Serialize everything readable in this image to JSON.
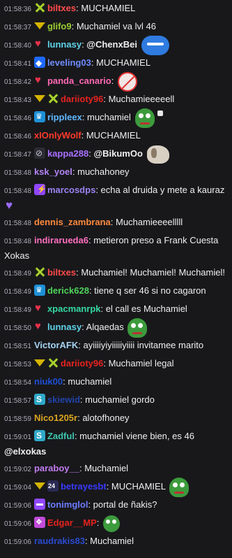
{
  "messages": [
    {
      "ts": "01:58:36",
      "badges": [
        "x-icon"
      ],
      "user": "biltxes",
      "user_color": "#ff4b4b",
      "parts": [
        {
          "t": "text",
          "v": "MUCHAMIEL"
        }
      ]
    },
    {
      "ts": "01:58:37",
      "badges": [
        "chevron-icon"
      ],
      "user": "glifo9",
      "user_color": "#9acd32",
      "parts": [
        {
          "t": "text",
          "v": "Muchamiel va lvl 46"
        }
      ]
    },
    {
      "ts": "01:58:40",
      "badges": [
        "heart-icon"
      ],
      "user": "lunnasy",
      "user_color": "#5fd3e8",
      "parts": [
        {
          "t": "mention",
          "v": "@ChenxBei"
        },
        {
          "t": "emote",
          "v": "e-blue"
        }
      ]
    },
    {
      "ts": "01:58:41",
      "badges": [
        "diamond-icon"
      ],
      "user": "leveling03",
      "user_color": "#6f8cff",
      "parts": [
        {
          "t": "text",
          "v": "MUCHAMIEL"
        }
      ]
    },
    {
      "ts": "01:58:42",
      "badges": [
        "heart-icon"
      ],
      "user": "panda_canario",
      "user_color": "#ff69b4",
      "parts": [
        {
          "t": "emote",
          "v": "e-nope"
        }
      ]
    },
    {
      "ts": "01:58:43",
      "badges": [
        "chevron-icon",
        "x-icon"
      ],
      "user": "dariioty96",
      "user_color": "#e5231f",
      "parts": [
        {
          "t": "text",
          "v": "Muchamieeeeell"
        }
      ]
    },
    {
      "ts": "01:58:46",
      "badges": [
        "crown-icon"
      ],
      "user": "rippleex",
      "user_color": "#5fb8ff",
      "parts": [
        {
          "t": "text",
          "v": "muchamiel"
        },
        {
          "t": "emote",
          "v": "e-frog"
        },
        {
          "t": "emote",
          "v": "e-tiny"
        }
      ]
    },
    {
      "ts": "01:58:46",
      "badges": [],
      "user": "xIOnlyWolf",
      "user_color": "#ff3a2a",
      "parts": [
        {
          "t": "text",
          "v": "MUCHAMIEL"
        }
      ]
    },
    {
      "ts": "01:58:47",
      "badges": [
        "no-icon"
      ],
      "user": "kappa288",
      "user_color": "#a970ff",
      "parts": [
        {
          "t": "mention",
          "v": "@BikumOo"
        },
        {
          "t": "emote",
          "v": "e-dog"
        }
      ]
    },
    {
      "ts": "01:58:48",
      "badges": [],
      "user": "ksk_yoel",
      "user_color": "#b284f2",
      "parts": [
        {
          "t": "text",
          "v": "muchahoney"
        }
      ]
    },
    {
      "ts": "01:58:48",
      "badges": [
        "bolt-icon"
      ],
      "user": "marcosdps",
      "user_color": "#9b82f0",
      "parts": [
        {
          "t": "text",
          "v": "echa al druida y mete a kauraz"
        },
        {
          "t": "emote",
          "v": "e-heart"
        }
      ]
    },
    {
      "ts": "01:58:48",
      "badges": [],
      "user": "dennis_zambrana",
      "user_color": "#ff8a3d",
      "parts": [
        {
          "t": "text",
          "v": "Muchamieeeelllll"
        }
      ]
    },
    {
      "ts": "01:58:48",
      "badges": [],
      "user": "indirarueda6",
      "user_color": "#ff6fbf",
      "parts": [
        {
          "t": "text",
          "v": "metieron preso a Frank Cuesta Xokas"
        }
      ]
    },
    {
      "ts": "01:58:49",
      "badges": [
        "x-icon"
      ],
      "user": "biltxes",
      "user_color": "#ff4b4b",
      "parts": [
        {
          "t": "text",
          "v": "Muchamiel! Muchamiel! Muchamiel!"
        }
      ]
    },
    {
      "ts": "01:58:49",
      "badges": [
        "crown-icon"
      ],
      "user": "derick628",
      "user_color": "#4fd35a",
      "parts": [
        {
          "t": "text",
          "v": "tiene q ser 46 si no cagaron"
        }
      ]
    },
    {
      "ts": "01:58:49",
      "badges": [
        "heart-icon"
      ],
      "user": "xpacmanrpk",
      "user_color": "#36d9a2",
      "parts": [
        {
          "t": "text",
          "v": "el call es Muchamiel"
        }
      ]
    },
    {
      "ts": "01:58:50",
      "badges": [
        "heart-icon"
      ],
      "user": "lunnasy",
      "user_color": "#5fd3e8",
      "parts": [
        {
          "t": "text",
          "v": "Alqaedas"
        },
        {
          "t": "emote",
          "v": "e-frog"
        }
      ]
    },
    {
      "ts": "01:58:51",
      "badges": [],
      "user": "VictorAFK",
      "user_color": "#a6d3f2",
      "parts": [
        {
          "t": "text",
          "v": "ayiiiiyiyiiiiiyiiii invitamee marito"
        }
      ]
    },
    {
      "ts": "01:58:53",
      "badges": [
        "chevron-icon",
        "x-icon"
      ],
      "user": "dariioty96",
      "user_color": "#e5231f",
      "parts": [
        {
          "t": "text",
          "v": "Muchamiel legal"
        }
      ]
    },
    {
      "ts": "01:58:54",
      "badges": [],
      "user": "niuk00",
      "user_color": "#1f4fd6",
      "parts": [
        {
          "t": "text",
          "v": "muchamiel"
        }
      ]
    },
    {
      "ts": "01:58:57",
      "badges": [
        "s-icon"
      ],
      "user": "skiewid",
      "user_color": "#2244aa",
      "parts": [
        {
          "t": "text",
          "v": "muchamiel gordo"
        }
      ]
    },
    {
      "ts": "01:58:59",
      "badges": [],
      "user": "Nico1205r",
      "user_color": "#daa520",
      "parts": [
        {
          "t": "text",
          "v": "alotofhoney"
        }
      ]
    },
    {
      "ts": "01:59:01",
      "badges": [
        "s-icon"
      ],
      "user": "Zadful",
      "user_color": "#3dc6b0",
      "parts": [
        {
          "t": "text",
          "v": "muchamiel viene bien, es 46"
        },
        {
          "t": "mention",
          "v": "@elxokas"
        }
      ]
    },
    {
      "ts": "01:59:02",
      "badges": [],
      "user": "paraboy__",
      "user_color": "#c27cf0",
      "parts": [
        {
          "t": "text",
          "v": "Muchamiel"
        }
      ]
    },
    {
      "ts": "01:59:04",
      "badges": [
        "chevron-icon",
        "calendar-icon"
      ],
      "user": "betrayesbt",
      "user_color": "#3a3aff",
      "parts": [
        {
          "t": "text",
          "v": "MUCHAMIEL"
        },
        {
          "t": "emote",
          "v": "e-frog"
        }
      ]
    },
    {
      "ts": "01:59:06",
      "badges": [
        "chat-icon"
      ],
      "user": "tonimglol",
      "user_color": "#6d7bff",
      "parts": [
        {
          "t": "text",
          "v": "portal de ñakis?"
        }
      ]
    },
    {
      "ts": "01:59:06",
      "badges": [
        "gift-icon"
      ],
      "user": "Edgar__MP",
      "user_color": "#e5231f",
      "parts": [
        {
          "t": "emote",
          "v": "e-frog-sm"
        }
      ]
    },
    {
      "ts": "01:59:06",
      "badges": [],
      "user": "raudrakis83",
      "user_color": "#2a4ad0",
      "parts": [
        {
          "t": "text",
          "v": "Muchamiel"
        }
      ]
    }
  ]
}
